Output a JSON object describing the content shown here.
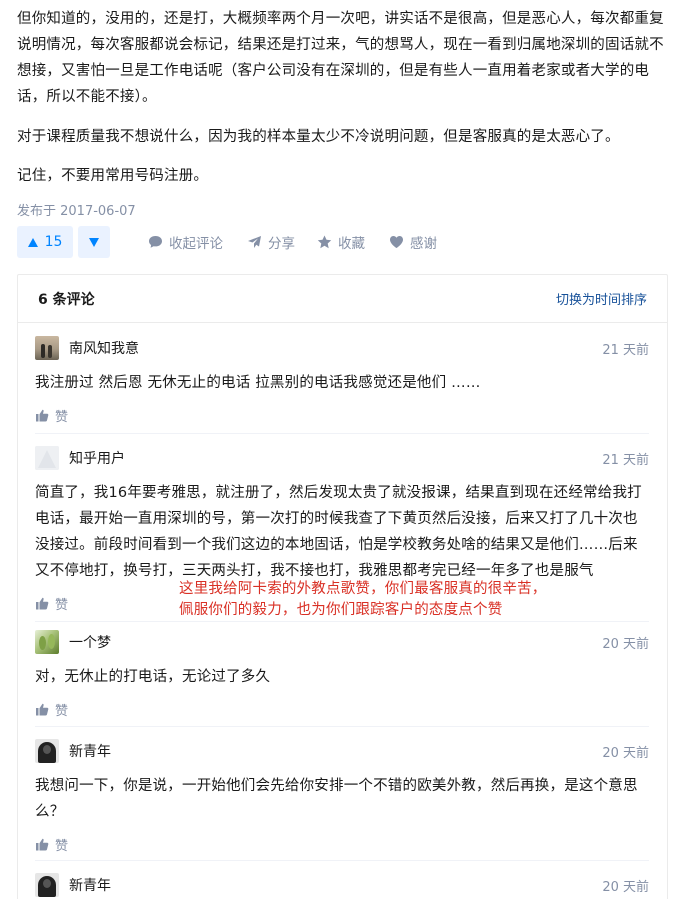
{
  "article": {
    "paragraphs": [
      "但你知道的，没用的，还是打，大概频率两个月一次吧，讲实话不是很高，但是恶心人，每次都重复说明情况，每次客服都说会标记，结果还是打过来，气的想骂人，现在一看到归属地深圳的固话就不想接，又害怕一旦是工作电话呢（客户公司没有在深圳的，但是有些人一直用着老家或者大学的电话，所以不能不接）。",
      "对于课程质量我不想说什么，因为我的样本量太少不冷说明问题，但是客服真的是太恶心了。",
      "记住，不要用常用号码注册。"
    ],
    "published": "发布于 2017-06-07"
  },
  "actions": {
    "upvote_count": "15",
    "collapse_comments": "收起评论",
    "share": "分享",
    "favorite": "收藏",
    "thanks": "感谢",
    "accent_color": "#0084ff",
    "muted_color": "#8590a6"
  },
  "comments_panel": {
    "count_label": "6 条评论",
    "sort_toggle": "切换为时间排序",
    "like_label": "赞",
    "items": [
      {
        "author": "南风知我意",
        "time": "21 天前",
        "text": "我注册过  然后恩 无休无止的电话  拉黑别的电话我感觉还是他们 ……",
        "avatar": "photo-avatar"
      },
      {
        "author": "知乎用户",
        "time": "21 天前",
        "text": "简直了，我16年要考雅思，就注册了，然后发现太贵了就没报课，结果直到现在还经常给我打电话，最开始一直用深圳的号，第一次打的时候我查了下黄页然后没接，后来又打了几十次也没接过。前段时间看到一个我们这边的本地固话，怕是学校教务处啥的结果又是他们……后来又不停地打，换号打，三天两头打，我不接也打，我雅思都考完已经一年多了也是服气",
        "avatar": "default-avatar"
      },
      {
        "author": "一个梦",
        "time": "20 天前",
        "text": "对，无休止的打电话，无论过了多久",
        "avatar": "photo-avatar"
      },
      {
        "author": "新青年",
        "time": "20 天前",
        "text": "我想问一下，你是说，一开始他们会先给你安排一个不错的欧美外教，然后再换，是这个意思么？",
        "avatar": "photo-avatar"
      },
      {
        "author": "新青年",
        "time": "20 天前",
        "text": "",
        "avatar": "photo-avatar"
      }
    ]
  },
  "overlay_annotation": {
    "line1": "这里我给阿卡索的外教点歌赞，你们最客服真的很辛苦，",
    "line2": "佩服你们的毅力，也为你们跟踪客户的态度点个赞",
    "color": "#d93025"
  }
}
